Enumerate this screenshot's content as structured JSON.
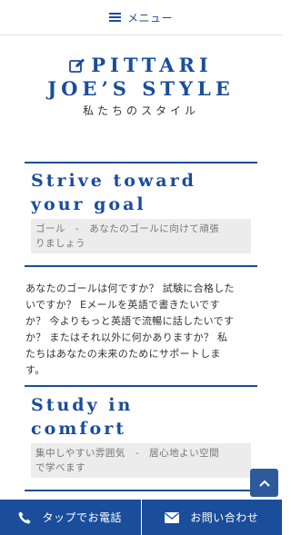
{
  "header": {
    "menu_label": "メニュー",
    "menu_icon": "hamburger-icon"
  },
  "logo": {
    "icon": "edit-icon",
    "line1": "PITTARI",
    "line2": "JOE’S STYLE",
    "tagline": "私たちのスタイル"
  },
  "sections": [
    {
      "title_line1": "Strive toward",
      "title_line2": "your goal",
      "subtitle_line1": "ゴール　-　あなたのゴールに向けて頑張",
      "subtitle_line2": "りましょう"
    },
    {
      "title_line1": "Study in",
      "title_line2": "comfort",
      "subtitle_line1": "集中しやすい雰囲気　-　居心地よい空間",
      "subtitle_line2": "で学べます"
    }
  ],
  "body": {
    "lines": [
      "あなたのゴールは何ですか？ 試験に合格した",
      "いですか？ Eメールを英語で書きたいです",
      "か？ 今よりもっと英語で流暢に話したいです",
      "か？ またはそれ以外に何かありますか？ 私",
      "たちはあなたの未来のためにサポートしま",
      "す。"
    ]
  },
  "scroll_top": {
    "icon": "chevron-up-icon"
  },
  "footer": {
    "phone_label": "タップでお電話",
    "phone_icon": "phone-icon",
    "contact_label": "お問い合わせ",
    "contact_icon": "envelope-icon"
  },
  "colors": {
    "brand": "#1a4d9a",
    "subtitle_bg": "#ececec"
  }
}
